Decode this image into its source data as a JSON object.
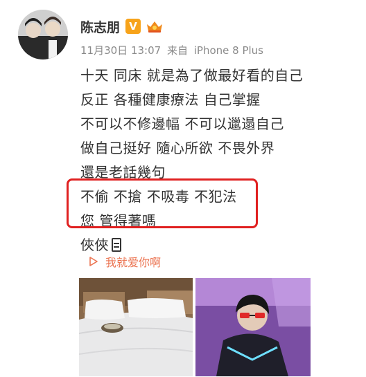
{
  "user": {
    "name": "陈志朋",
    "verified_badge": "V"
  },
  "post": {
    "date": "11月30日 13:07",
    "source_prefix": "来自",
    "source_device": "iPhone 8 Plus",
    "lines": [
      "十天 同床 就是為了做最好看的自己",
      "反正 各種健康療法 自己掌握",
      "不可以不修邊幅 不可以邋遢自己",
      "做自己挺好 隨心所欲 不畏外界",
      "還是老話幾句",
      "不偷 不搶 不吸毒 不犯法",
      "您 管得著嗎",
      "俠俠"
    ],
    "music_link": "我就爱你啊"
  },
  "colors": {
    "link": "#eb7350",
    "meta": "#8a8a8a",
    "highlight": "#e02020",
    "badge": "#f7a31a"
  }
}
